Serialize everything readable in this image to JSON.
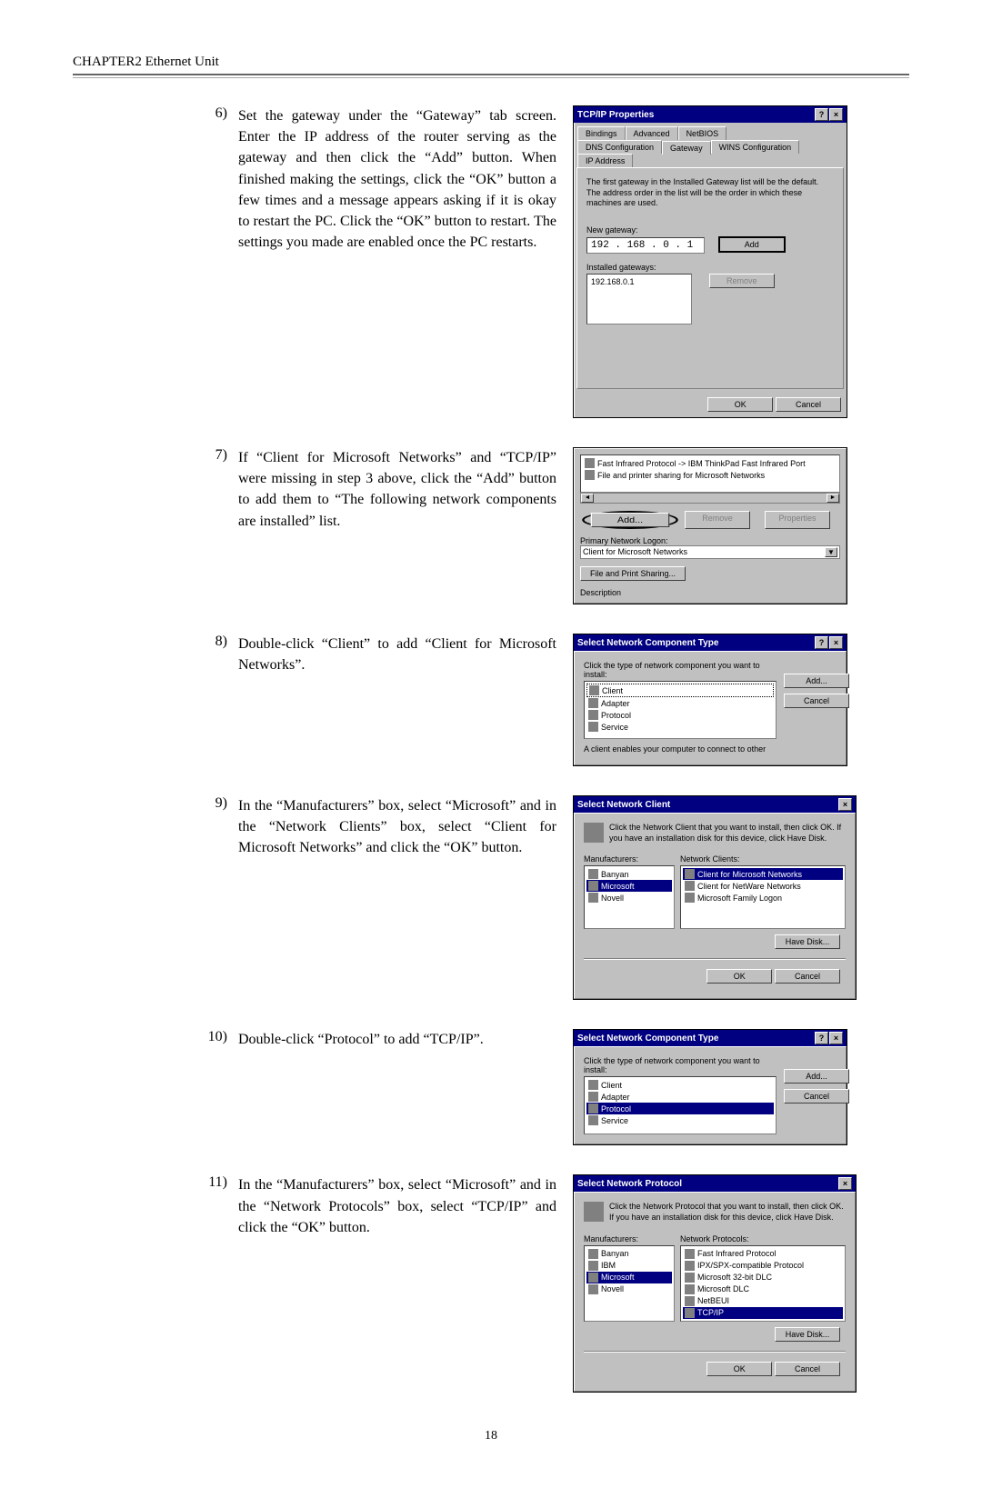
{
  "header": "CHAPTER2  Ethernet Unit",
  "page_number": "18",
  "steps": {
    "6": {
      "num": "6)",
      "text": "Set the gateway under the “Gateway” tab screen. Enter the IP address of the router serving as the gateway and then click the “Add” button. When finished making the settings, click the “OK” button a few times and a message appears asking if it is okay to restart the PC. Click the “OK” button to restart. The settings you made are enabled once the PC restarts."
    },
    "7": {
      "num": "7)",
      "text": "If “Client for Microsoft Networks” and “TCP/IP” were missing in step 3 above, click the “Add” button to add them to “The following network components are installed” list."
    },
    "8": {
      "num": "8)",
      "text": "Double-click “Client” to add “Client for Microsoft Networks”."
    },
    "9": {
      "num": "9)",
      "text": "In the “Manufacturers” box, select “Microsoft” and in the “Network Clients” box, select “Client for Microsoft Networks” and click the “OK” button."
    },
    "10": {
      "num": "10)",
      "text": "Double-click “Protocol” to add “TCP/IP”."
    },
    "11": {
      "num": "11)",
      "text": "In the “Manufacturers” box, select “Microsoft” and in the “Network Protocols” box, select “TCP/IP” and click the “OK” button."
    }
  },
  "dlg6": {
    "title": "TCP/IP Properties",
    "tabs_row1": [
      "Bindings",
      "Advanced",
      "NetBIOS"
    ],
    "tabs_row2": [
      "DNS Configuration",
      "Gateway",
      "WINS Configuration",
      "IP Address"
    ],
    "info": "The first gateway in the Installed Gateway list will be the default. The address order in the list will be the order in which these machines are used.",
    "new_gw_label": "New gateway:",
    "new_gw_value": "192 . 168 .  0  .  1",
    "add_btn": "Add",
    "inst_gw_label": "Installed gateways:",
    "inst_gw_value": "192.168.0.1",
    "remove_btn": "Remove",
    "ok": "OK",
    "cancel": "Cancel"
  },
  "dlg7": {
    "item1": "Fast Infrared Protocol -> IBM ThinkPad Fast Infrared Port",
    "item2": "File and printer sharing for Microsoft Networks",
    "add": "Add...",
    "remove": "Remove",
    "properties": "Properties",
    "primary_label": "Primary Network Logon:",
    "primary_value": "Client for Microsoft Networks",
    "fileprint": "File and Print Sharing...",
    "desc": "Description"
  },
  "dlg8": {
    "title": "Select Network Component Type",
    "prompt": "Click the type of network component you want to install:",
    "items": [
      "Client",
      "Adapter",
      "Protocol",
      "Service"
    ],
    "add": "Add...",
    "cancel": "Cancel",
    "footer": "A client enables your computer to connect to other"
  },
  "dlg9": {
    "title": "Select Network Client",
    "prompt": "Click the Network Client that you want to install, then click OK. If you have an installation disk for this device, click Have Disk.",
    "mfg_label": "Manufacturers:",
    "mfg": [
      "Banyan",
      "Microsoft",
      "Novell"
    ],
    "clients_label": "Network Clients:",
    "clients": [
      "Client for Microsoft Networks",
      "Client for NetWare Networks",
      "Microsoft Family Logon"
    ],
    "havedisk": "Have Disk...",
    "ok": "OK",
    "cancel": "Cancel"
  },
  "dlg10": {
    "title": "Select Network Component Type",
    "prompt": "Click the type of network component you want to install:",
    "items": [
      "Client",
      "Adapter",
      "Protocol",
      "Service"
    ],
    "add": "Add...",
    "cancel": "Cancel"
  },
  "dlg11": {
    "title": "Select Network Protocol",
    "prompt": "Click the Network Protocol that you want to install, then click OK. If you have an installation disk for this device, click Have Disk.",
    "mfg_label": "Manufacturers:",
    "mfg": [
      "Banyan",
      "IBM",
      "Microsoft",
      "Novell"
    ],
    "proto_label": "Network Protocols:",
    "proto": [
      "Fast Infrared Protocol",
      "IPX/SPX-compatible Protocol",
      "Microsoft 32-bit DLC",
      "Microsoft DLC",
      "NetBEUI",
      "TCP/IP"
    ],
    "havedisk": "Have Disk...",
    "ok": "OK",
    "cancel": "Cancel"
  }
}
